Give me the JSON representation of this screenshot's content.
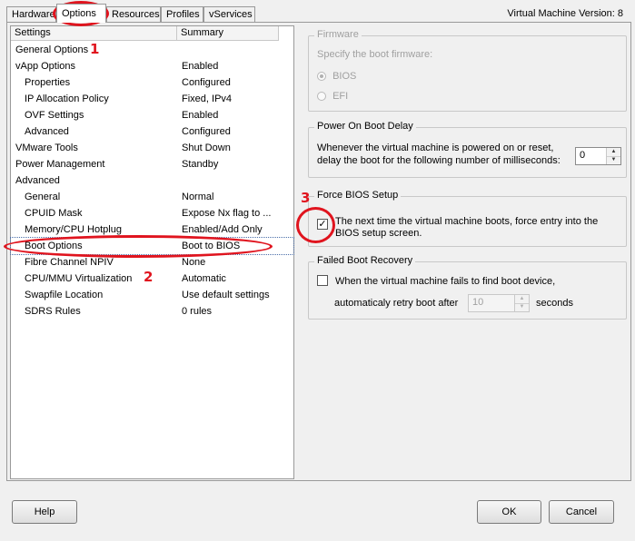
{
  "tabs": [
    "Hardware",
    "Options",
    "Resources",
    "Profiles",
    "vServices"
  ],
  "vm_version": "Virtual Machine Version: 8",
  "list": {
    "headers": {
      "settings": "Settings",
      "summary": "Summary"
    },
    "rows": [
      {
        "label": "General Options",
        "summary": "",
        "indent": 0
      },
      {
        "label": "vApp Options",
        "summary": "Enabled",
        "indent": 0
      },
      {
        "label": "Properties",
        "summary": "Configured",
        "indent": 1
      },
      {
        "label": "IP Allocation Policy",
        "summary": "Fixed, IPv4",
        "indent": 1
      },
      {
        "label": "OVF Settings",
        "summary": "Enabled",
        "indent": 1
      },
      {
        "label": "Advanced",
        "summary": "Configured",
        "indent": 1
      },
      {
        "label": "VMware Tools",
        "summary": "Shut Down",
        "indent": 0
      },
      {
        "label": "Power Management",
        "summary": "Standby",
        "indent": 0
      },
      {
        "label": "Advanced",
        "summary": "",
        "indent": 0
      },
      {
        "label": "General",
        "summary": "Normal",
        "indent": 1
      },
      {
        "label": "CPUID Mask",
        "summary": "Expose Nx flag to ...",
        "indent": 1
      },
      {
        "label": "Memory/CPU Hotplug",
        "summary": "Enabled/Add Only",
        "indent": 1
      },
      {
        "label": "Boot Options",
        "summary": "Boot to BIOS",
        "indent": 1,
        "selected": true
      },
      {
        "label": "Fibre Channel NPIV",
        "summary": "None",
        "indent": 1
      },
      {
        "label": "CPU/MMU Virtualization",
        "summary": "Automatic",
        "indent": 1
      },
      {
        "label": "Swapfile Location",
        "summary": "Use default settings",
        "indent": 1
      },
      {
        "label": "SDRS Rules",
        "summary": "0 rules",
        "indent": 1
      }
    ]
  },
  "firmware": {
    "title": "Firmware",
    "desc": "Specify the boot firmware:",
    "options": [
      "BIOS",
      "EFI"
    ],
    "selected": "BIOS"
  },
  "boot_delay": {
    "title": "Power On Boot Delay",
    "line1": "Whenever the virtual machine is powered on or reset,",
    "line2": "delay the boot for the following number of milliseconds:",
    "value": "0"
  },
  "force_bios": {
    "title": "Force BIOS Setup",
    "checked": true,
    "line1": "The next time the virtual machine boots, force entry into the",
    "line2": "BIOS setup screen."
  },
  "failed_recovery": {
    "title": "Failed Boot Recovery",
    "checked": false,
    "line1": "When the virtual machine fails to find boot device,",
    "line2_prefix": "automaticaly retry boot after",
    "value": "10",
    "suffix": "seconds"
  },
  "buttons": {
    "help": "Help",
    "ok": "OK",
    "cancel": "Cancel"
  },
  "annotations": [
    "1",
    "2",
    "3"
  ],
  "colors": {
    "annotation": "#e0141e",
    "selection_outline": "#4a6ea9"
  }
}
